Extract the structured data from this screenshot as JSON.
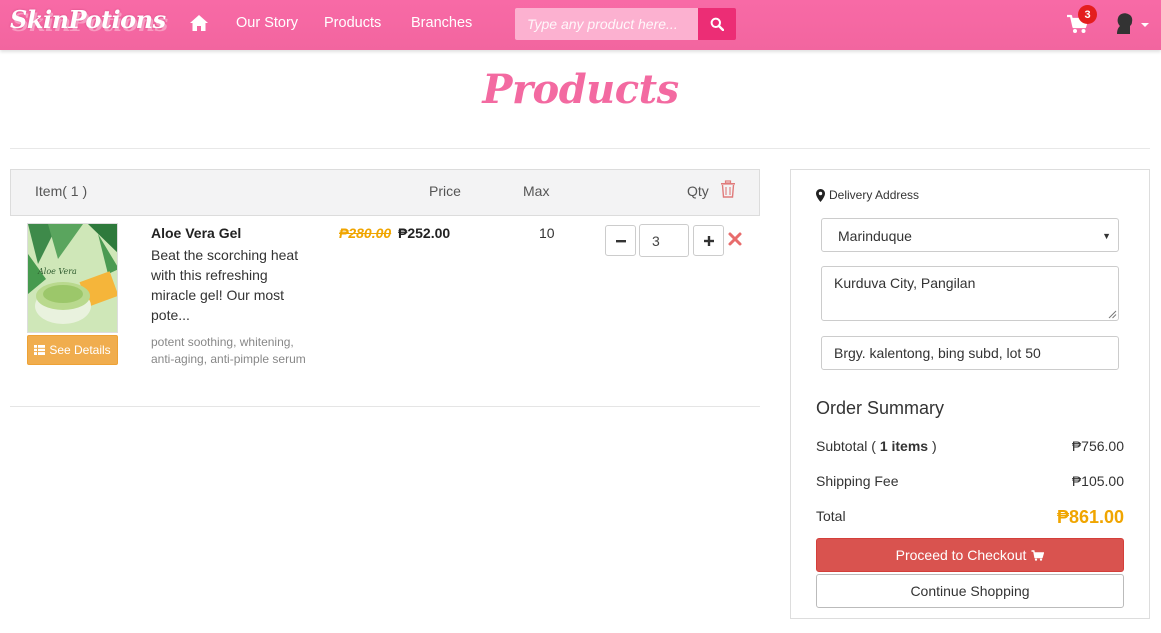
{
  "navbar": {
    "brand": "SkinPotions",
    "links": [
      "Our Story",
      "Products",
      "Branches"
    ],
    "search_placeholder": "Type any product here...",
    "cart_count": "3",
    "color": "#f2659f"
  },
  "page": {
    "title": "Products"
  },
  "cart_table": {
    "headers": {
      "item": "Item( 1 )",
      "price": "Price",
      "max": "Max",
      "qty": "Qty"
    },
    "items": [
      {
        "name": "Aloe Vera Gel",
        "description": "Beat the scorching heat with this refreshing miracle gel! Our most pote...",
        "tags": "potent soothing, whitening, anti-aging, anti-pimple serum",
        "image_label": "Aloe Vera",
        "see_details_label": "See Details",
        "old_price": "₱280.00",
        "price": "₱252.00",
        "max": "10",
        "qty": "3"
      }
    ]
  },
  "delivery": {
    "label": "Delivery Address",
    "province": "Marinduque",
    "address_line": "Kurduva City, Pangilan",
    "address_detail": "Brgy. kalentong, bing subd, lot 50"
  },
  "summary": {
    "title": "Order Summary",
    "subtotal_prefix": "Subtotal ( ",
    "subtotal_items": "1 items",
    "subtotal_suffix": " )",
    "subtotal_value": "₱756.00",
    "shipping_label": "Shipping Fee",
    "shipping_value": "₱105.00",
    "total_label": "Total",
    "total_value": "₱861.00",
    "checkout_label": "Proceed to Checkout",
    "continue_label": "Continue Shopping"
  },
  "colors": {
    "brand_pink": "#f36aa1",
    "accent_orange": "#f0a500",
    "danger_red": "#d9534f",
    "details_orange": "#f0ad4e"
  }
}
